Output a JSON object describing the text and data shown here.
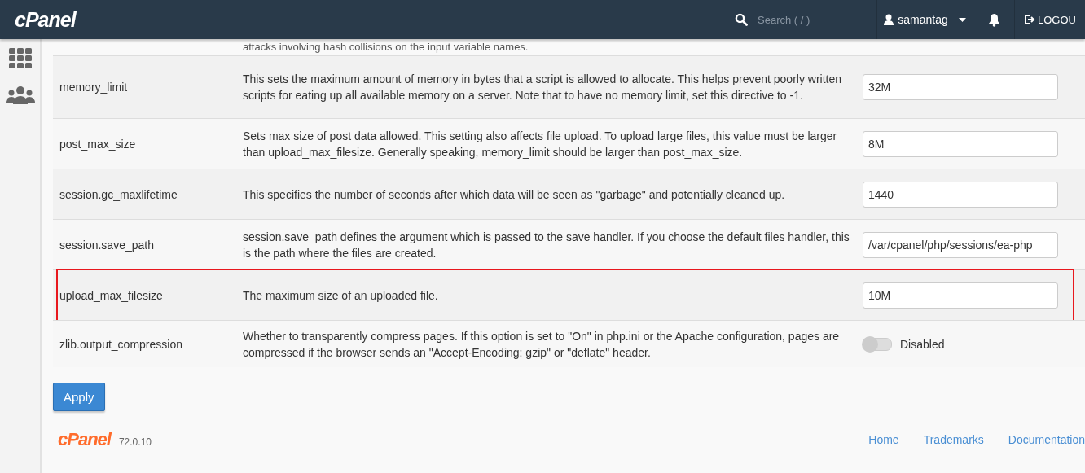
{
  "header": {
    "logo": "cPanel",
    "search": {
      "placeholder": "Search ( / )"
    },
    "user": "samantag",
    "logout": "LOGOU"
  },
  "settings": [
    {
      "kind": "partial",
      "description": "attacks involving hash collisions on the input variable names."
    },
    {
      "kind": "text",
      "name": "memory_limit",
      "description": "This sets the maximum amount of memory in bytes that a script is allowed to allocate. This helps prevent poorly written scripts for eating up all available memory on a server. Note that to have no memory limit, set this directive to -1.",
      "value": "32M",
      "highlighted": false
    },
    {
      "kind": "text",
      "name": "post_max_size",
      "description": "Sets max size of post data allowed. This setting also affects file upload. To upload large files, this value must be larger than upload_max_filesize. Generally speaking, memory_limit should be larger than post_max_size.",
      "value": "8M",
      "highlighted": false
    },
    {
      "kind": "text",
      "name": "session.gc_maxlifetime",
      "description": "This specifies the number of seconds after which data will be seen as \"garbage\" and potentially cleaned up.",
      "value": "1440",
      "highlighted": false
    },
    {
      "kind": "text",
      "name": "session.save_path",
      "description": "session.save_path defines the argument which is passed to the save handler. If you choose the default files handler, this is the path where the files are created.",
      "value": "/var/cpanel/php/sessions/ea-php",
      "highlighted": false
    },
    {
      "kind": "text",
      "name": "upload_max_filesize",
      "description": "The maximum size of an uploaded file.",
      "value": "10M",
      "highlighted": true
    },
    {
      "kind": "toggle",
      "name": "zlib.output_compression",
      "description": "Whether to transparently compress pages. If this option is set to \"On\" in php.ini or the Apache configuration, pages are compressed if the browser sends an \"Accept-Encoding: gzip\" or \"deflate\" header.",
      "on": false,
      "state_label": "Disabled",
      "highlighted": false
    }
  ],
  "apply_button": "Apply",
  "footer": {
    "logo": "cPanel",
    "version": "72.0.10",
    "links": [
      "Home",
      "Trademarks",
      "Documentation"
    ]
  }
}
